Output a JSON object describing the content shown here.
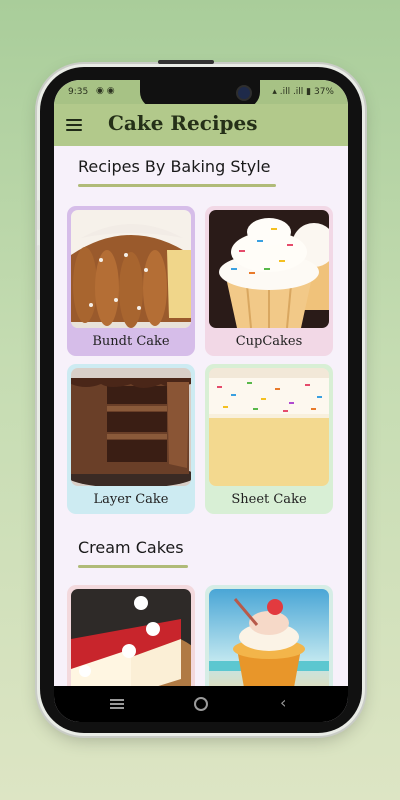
{
  "status_bar": {
    "time": "9:35",
    "notification_icons": "◉ ◉",
    "right_icons": "▴ .ill .ill ▮ 37%"
  },
  "app_bar": {
    "title": "Cake Recipes",
    "menu_icon": "hamburger-menu-icon"
  },
  "sections": [
    {
      "title": "Recipes By Baking Style",
      "cards": [
        {
          "label": "Bundt Cake",
          "bg_color": "#d6bde9",
          "image": "bundt-cake"
        },
        {
          "label": "CupCakes",
          "bg_color": "#f2d8e6",
          "image": "cupcake"
        },
        {
          "label": "Layer Cake",
          "bg_color": "#cdebf2",
          "image": "layer-cake"
        },
        {
          "label": "Sheet Cake",
          "bg_color": "#d8efd5",
          "image": "sheet-cake"
        }
      ]
    },
    {
      "title": "Cream Cakes",
      "cards": [
        {
          "label": "",
          "bg_color": "#f3d9dd",
          "image": "cheesecake"
        },
        {
          "label": "",
          "bg_color": "#d6ede6",
          "image": "cupcake-dessert"
        }
      ]
    }
  ],
  "nav_bar": {
    "recents_icon": "recents-icon",
    "home_icon": "home-icon",
    "back_icon": "back-icon"
  }
}
